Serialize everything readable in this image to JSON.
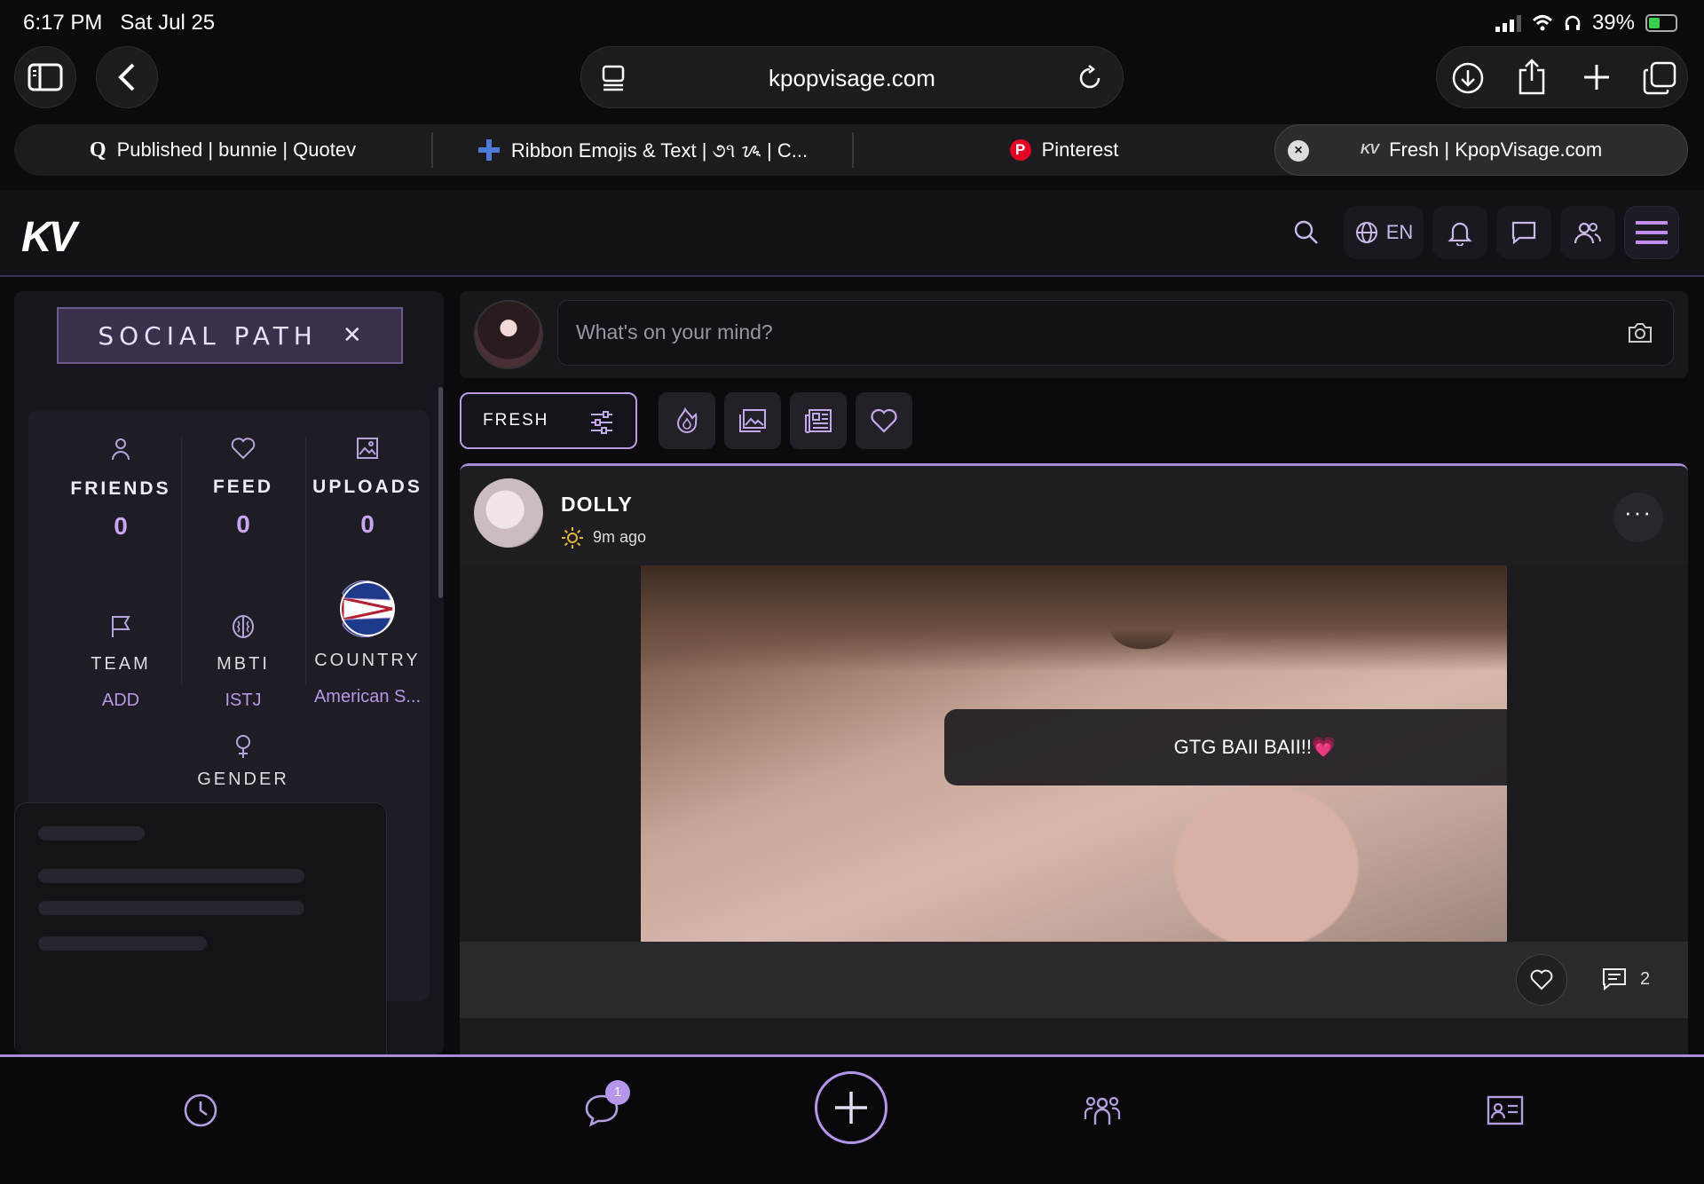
{
  "status_bar": {
    "time": "6:17 PM",
    "date": "Sat Jul 25",
    "battery": "39%"
  },
  "browser": {
    "url": "kpopvisage.com",
    "tabs": [
      {
        "label": "Published | bunnie | Quotev",
        "icon": "quotev-icon"
      },
      {
        "label": "Ribbon Emojis & Text | ૭૧ ᝰ | C...",
        "icon": "plus-cross-icon"
      },
      {
        "label": "Pinterest",
        "icon": "pinterest-icon"
      },
      {
        "label": "Fresh | KpopVisage.com",
        "icon": "kv-icon"
      }
    ]
  },
  "site": {
    "logo": "KV",
    "language": "EN"
  },
  "sidebar": {
    "title": "SOCIAL PATH",
    "stats": [
      {
        "label": "FRIENDS",
        "value": "0"
      },
      {
        "label": "FEED",
        "value": "0"
      },
      {
        "label": "UPLOADS",
        "value": "0"
      }
    ],
    "profile": [
      {
        "label": "TEAM",
        "value": "ADD"
      },
      {
        "label": "MBTI",
        "value": "ISTJ"
      },
      {
        "label": "COUNTRY",
        "value": "American S..."
      }
    ],
    "gender_label": "GENDER"
  },
  "composer": {
    "placeholder": "What's on your mind?"
  },
  "filters": {
    "active": "FRESH"
  },
  "post": {
    "author": "DOLLY",
    "time": "9m ago",
    "caption": "GTG BAII BAII!!💗",
    "comment_count": "2"
  },
  "bottom_nav": {
    "chat_badge": "1"
  },
  "colors": {
    "accent": "#a78bd6",
    "background": "#0b0b0d",
    "card": "#1b1a1f"
  }
}
